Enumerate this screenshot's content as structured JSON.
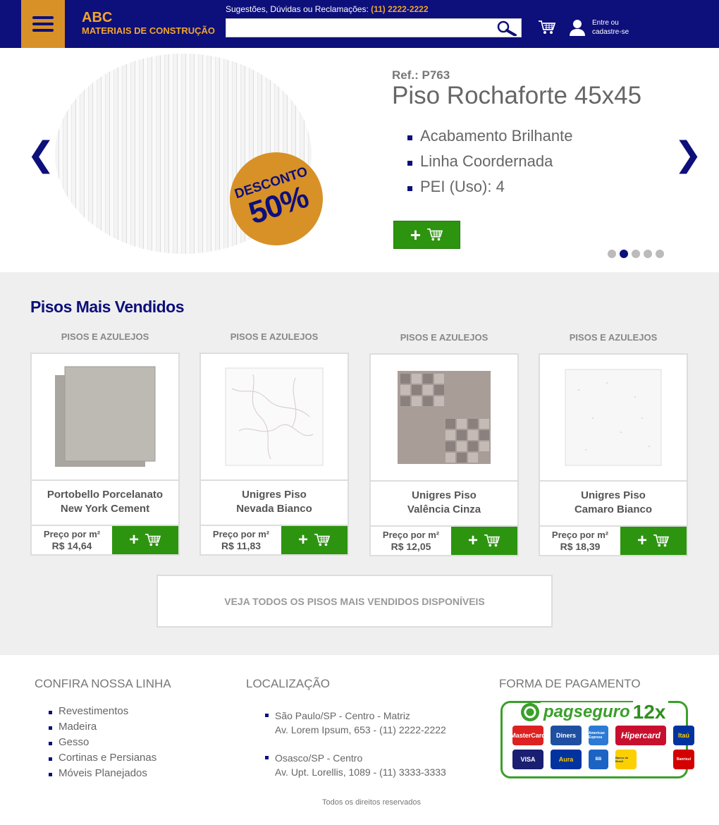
{
  "header": {
    "logo_line1": "ABC",
    "logo_line2": "MATERIAIS DE CONSTRUÇÃO",
    "contact_label": "Sugestões, Dúvidas ou Reclamações:",
    "contact_phone": "(11) 2222-2222",
    "search_placeholder": "",
    "login_label": "Entre ou cadastre-se"
  },
  "hero": {
    "ref": "Ref.: P763",
    "title": "Piso Rochaforte 45x45",
    "features": [
      "Acabamento Brilhante",
      "Linha Coordernada",
      "PEI (Uso): 4"
    ],
    "badge_line1": "DESCONTO",
    "badge_line2": "50%",
    "add_label": "+",
    "prev_label": "❮",
    "next_label": "❯",
    "slides": 5,
    "active_slide": 2
  },
  "best_sellers": {
    "title": "Pisos Mais Vendidos",
    "products": [
      {
        "category": "PISOS E AZULEJOS",
        "name_line1": "Portobello Porcelanato",
        "name_line2": "New York Cement",
        "price_label": "Preço por m²",
        "price": "R$ 14,64",
        "add_label": "+"
      },
      {
        "category": "PISOS E AZULEJOS",
        "name_line1": "Unigres Piso",
        "name_line2": "Nevada Bianco",
        "price_label": "Preço por m²",
        "price": "R$ 11,83",
        "add_label": "+"
      },
      {
        "category": "PISOS E AZULEJOS",
        "name_line1": "Unigres Piso",
        "name_line2": "Valência Cinza",
        "price_label": "Preço por m²",
        "price": "R$ 12,05",
        "add_label": "+"
      },
      {
        "category": "PISOS E AZULEJOS",
        "name_line1": "Unigres Piso",
        "name_line2": "Camaro Bianco",
        "price_label": "Preço por m²",
        "price": "R$ 18,39",
        "add_label": "+"
      }
    ],
    "see_all": "VEJA TODOS OS PISOS MAIS VENDIDOS DISPONÍVEIS"
  },
  "footer": {
    "line_title": "CONFIRA NOSSA LINHA",
    "line_items": [
      "Revestimentos",
      "Madeira",
      "Gesso",
      "Cortinas e Persianas",
      "Móveis Planejados"
    ],
    "location_title": "LOCALIZAÇÃO",
    "locations": [
      {
        "line1": "São Paulo/SP - Centro - Matriz",
        "line2": "Av. Lorem Ipsum, 653 - (11) 2222-2222"
      },
      {
        "line1": "Osasco/SP - Centro",
        "line2": "Av. Upt. Lorellis, 1089 - (11) 3333-3333"
      }
    ],
    "payment_title": "FORMA DE PAGAMENTO",
    "pagseguro_label": "pagseguro",
    "installments": "12x",
    "card_brands": [
      "MasterCard",
      "Diners",
      "American Express",
      "Hipercard",
      "Itaú",
      "VISA",
      "Aura",
      "BB",
      "Banco do Brasil",
      "Banrisul"
    ],
    "rights": "Todos os direitos reservados"
  },
  "colors": {
    "navy": "#0d0f7a",
    "orange": "#d79127",
    "green": "#2d9410"
  }
}
